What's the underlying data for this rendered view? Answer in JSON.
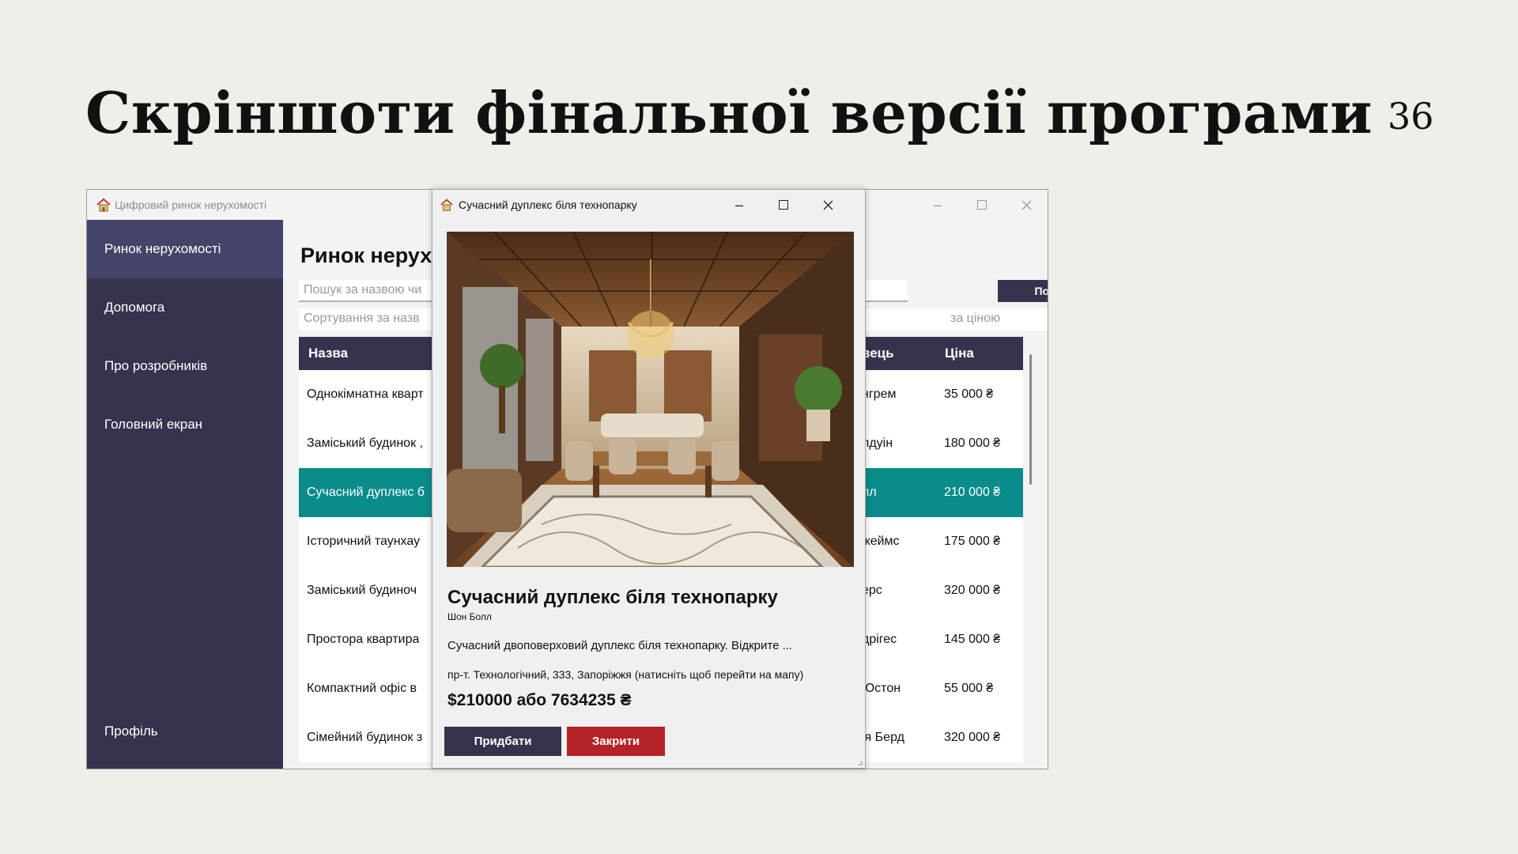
{
  "slide": {
    "title": "Скріншоти фінальної версії програми",
    "number": "36"
  },
  "main_window": {
    "title": "Цифровий ринок нерухомості",
    "sidebar": {
      "items": [
        {
          "label": "Ринок нерухомості",
          "active": true
        },
        {
          "label": "Допомога",
          "active": false
        },
        {
          "label": "Про розробників",
          "active": false
        },
        {
          "label": "Головний екран",
          "active": false
        }
      ],
      "profile_label": "Профіль"
    },
    "heading": "Ринок нерух",
    "search": {
      "placeholder": "Пошук за назвою чи",
      "button_label": "Пошук"
    },
    "sort": {
      "left_placeholder": "Сортування за назв",
      "right_placeholder": "за ціною"
    },
    "table": {
      "headers": {
        "name": "Назва",
        "seller": "вець",
        "price": "Ціна"
      },
      "rows": [
        {
          "name": "Однокімнатна кварт",
          "seller": "нгрем",
          "price": "35 000 ₴",
          "selected": false
        },
        {
          "name": "Заміський будинок ,",
          "seller": "лдуін",
          "price": "180 000 ₴",
          "selected": false
        },
        {
          "name": "Сучасний дуплекс б",
          "seller": "лл",
          "price": "210 000 ₴",
          "selected": true
        },
        {
          "name": "Історичний таунхау",
          "seller": "жеймс",
          "price": "175 000 ₴",
          "selected": false
        },
        {
          "name": "Заміський будиноч",
          "seller": "ерс",
          "price": "320 000 ₴",
          "selected": false
        },
        {
          "name": "Простора квартира",
          "seller": "дрігес",
          "price": "145 000 ₴",
          "selected": false
        },
        {
          "name": "Компактний офіс в",
          "seller": "Юстон",
          "price": "55 000 ₴",
          "selected": false
        },
        {
          "name": "Сімейний будинок з",
          "seller": "ія Берд",
          "price": "320 000 ₴",
          "selected": false
        }
      ]
    }
  },
  "dialog": {
    "title": "Сучасний дуплекс біля технопарку",
    "property": {
      "title": "Сучасний дуплекс біля технопарку",
      "owner": "Шон Болл",
      "description": "Сучасний двоповерховий дуплекс біля технопарку. Відкрите ...",
      "address": "пр-т. Технологічний, 333, Запоріжжя (натисніть щоб перейти на мапу)",
      "price": "$210000 або 7634235 ₴"
    },
    "buy_label": "Придбати",
    "close_label": "Закрити"
  },
  "colors": {
    "sidebar": "#35344f",
    "sidebar_active": "#44446a",
    "selected_row": "#0b8b8a",
    "close_button": "#b32226",
    "slide_background": "#efeee8"
  }
}
